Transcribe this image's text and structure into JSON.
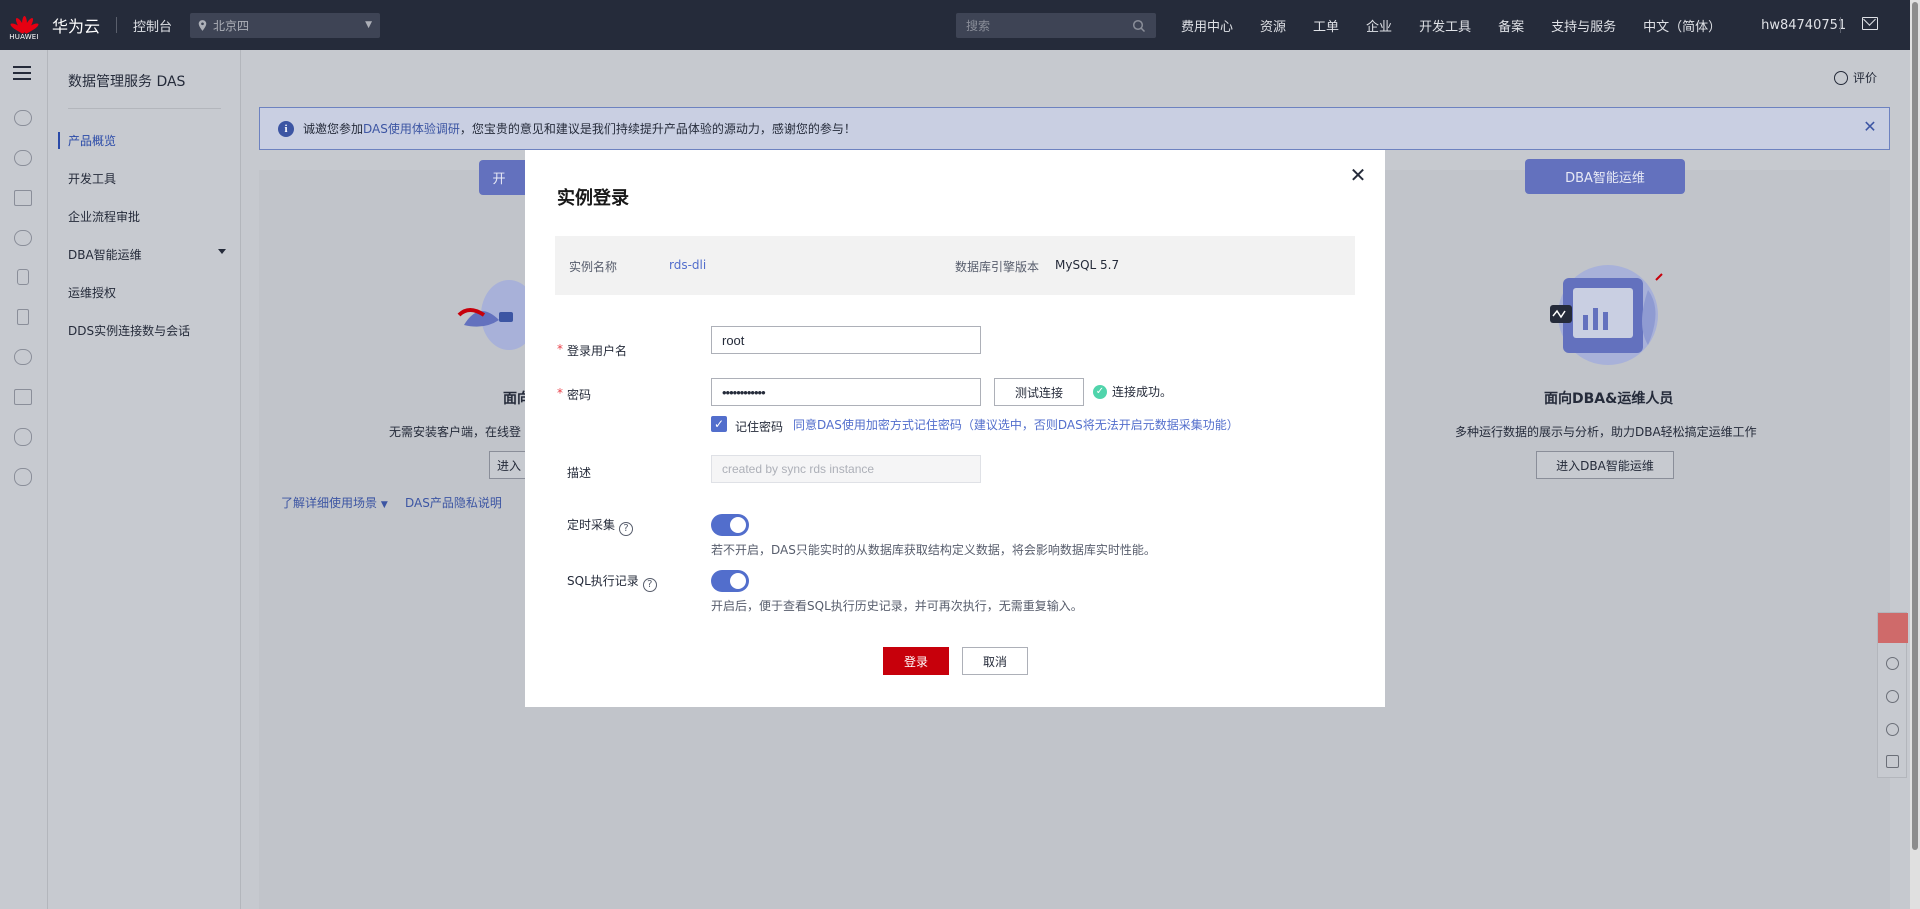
{
  "topbar": {
    "logo_text": "HUAWEI",
    "brand": "华为云",
    "console": "控制台",
    "region": "北京四",
    "search_placeholder": "搜索",
    "nav": [
      "费用中心",
      "资源",
      "工单",
      "企业",
      "开发工具",
      "备案",
      "支持与服务",
      "中文（简体）",
      "hw84740751"
    ],
    "brand_color": "#e60012"
  },
  "sidebar": {
    "title": "数据管理服务 DAS",
    "items": [
      {
        "label": "产品概览",
        "active": true
      },
      {
        "label": "开发工具"
      },
      {
        "label": "企业流程审批"
      },
      {
        "label": "DBA智能运维"
      },
      {
        "label": "运维授权"
      },
      {
        "label": "DDS实例连接数与会话"
      }
    ]
  },
  "main": {
    "rate": "评价",
    "banner": {
      "prefix": "诚邀您参加",
      "link": "DAS使用体验调研",
      "suffix": "，您宝贵的意见和建议是我们持续提升产品体验的源动力，感谢您的参与！"
    },
    "left_card": {
      "badge": "开",
      "title": "面向",
      "desc": "无需安装客户端，在线登",
      "button": "进入",
      "link1": "了解详细使用场景",
      "link2": "DAS产品隐私说明"
    },
    "right_card": {
      "badge": "DBA智能运维",
      "title": "面向DBA&运维人员",
      "desc": "多种运行数据的展示与分析，助力DBA轻松搞定运维工作",
      "button": "进入DBA智能运维"
    }
  },
  "modal": {
    "title": "实例登录",
    "instance_label": "实例名称",
    "instance_value": "rds-dli",
    "engine_label": "数据库引擎版本",
    "engine_value": "MySQL 5.7",
    "username_label": "登录用户名",
    "username_value": "root",
    "password_label": "密码",
    "password_value": "••••••••••••",
    "test_button": "测试连接",
    "test_result": "连接成功。",
    "remember_label": "记住密码",
    "remember_hint": "同意DAS使用加密方式记住密码（建议选中，否则DAS将无法开启元数据采集功能）",
    "desc_label": "描述",
    "desc_placeholder": "created by sync rds instance",
    "schedule_label": "定时采集",
    "schedule_on": true,
    "schedule_hint": "若不开启，DAS只能实时的从数据库获取结构定义数据，将会影响数据库实时性能。",
    "sqllog_label": "SQL执行记录",
    "sqllog_on": true,
    "sqllog_hint": "开启后，便于查看SQL执行历史记录，并可再次执行，无需重复输入。",
    "login_button": "登录",
    "cancel_button": "取消",
    "primary_color": "#c7000b",
    "accent_color": "#526ecc"
  }
}
